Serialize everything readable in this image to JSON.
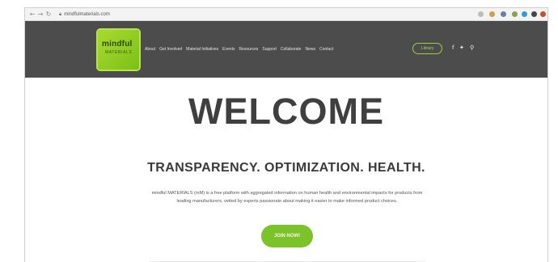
{
  "browser": {
    "back_icon": "arrow-left-icon",
    "forward_icon": "arrow-right-icon",
    "reload_icon": "reload-icon",
    "url": "mindfulmaterials.com",
    "extension_colors": [
      "#9b9b9b",
      "#c9a34a",
      "#6c7fa0",
      "#8aa04a",
      "#2f9bd1",
      "#444444",
      "#c6502c"
    ]
  },
  "header": {
    "logo_line1": "mindful",
    "logo_line2": "MATERIALS",
    "nav": [
      "About",
      "Get Involved",
      "Material Initiatives",
      "Events",
      "Resources",
      "Support",
      "Collaborate",
      "News",
      "Contact"
    ],
    "library_label": "Library",
    "social": [
      "facebook-icon",
      "twitter-icon",
      "search-icon"
    ]
  },
  "main": {
    "welcome": "WELCOME",
    "tagline": "TRANSPARENCY. OPTIMIZATION. HEALTH.",
    "description": "mindful MATERIALS (mM) is a free platform with aggregated information on human health and environmental impacts for products from leading manufacturers, vetted by experts passionate about making it easier to make informed product choices.",
    "join_label": "JOIN NOW!"
  },
  "colors": {
    "header_bg": "#4c4c4c",
    "accent": "#7cc22a",
    "heading": "#3f3f3f"
  }
}
